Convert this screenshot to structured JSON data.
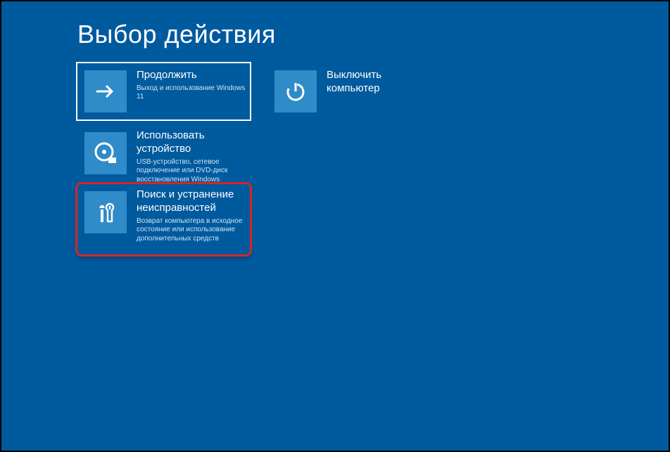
{
  "title": "Выбор действия",
  "tiles": {
    "continue": {
      "title": "Продолжить",
      "desc": "Выход и использование Windows 11"
    },
    "power": {
      "title": "Выключить компьютер"
    },
    "device": {
      "title": "Использовать устройство",
      "desc": "USB-устройство, сетевое подключение или DVD-диск восстановления Windows"
    },
    "trouble": {
      "title": "Поиск и устранение неисправностей",
      "desc": "Возврат компьютера в исходное состояние или использование дополнительных средств"
    }
  }
}
